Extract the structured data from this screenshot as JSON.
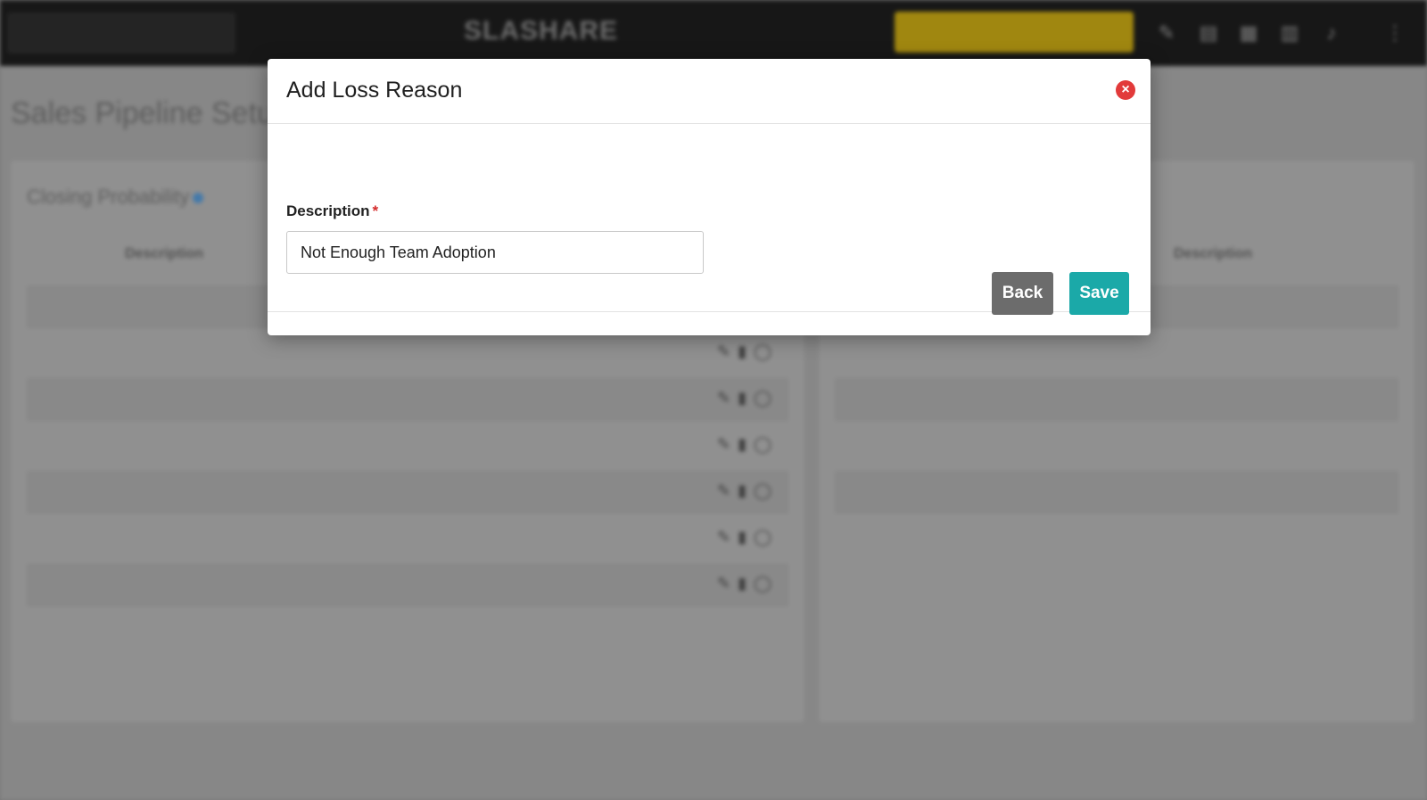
{
  "background": {
    "topbar": {
      "brand": "",
      "logo": "SLASHARE",
      "cta_label": "",
      "icons": [
        "edit-icon",
        "clipboard-icon",
        "calendar-icon",
        "chart-icon",
        "bell-icon",
        "more-icon"
      ]
    },
    "page_title": "Sales Pipeline Setup",
    "left_panel": {
      "heading": "Closing Probability",
      "column_header": "Description"
    },
    "right_panel": {
      "column_header": "Description"
    }
  },
  "modal": {
    "title": "Add Loss Reason",
    "field": {
      "label": "Description",
      "required_mark": "*",
      "value": "Not Enough Team Adoption"
    },
    "buttons": {
      "back": "Back",
      "save": "Save"
    }
  },
  "colors": {
    "save": "#1ba9a8",
    "back": "#6c6c6c",
    "close": "#e23a3a",
    "required": "#d42b2b"
  }
}
